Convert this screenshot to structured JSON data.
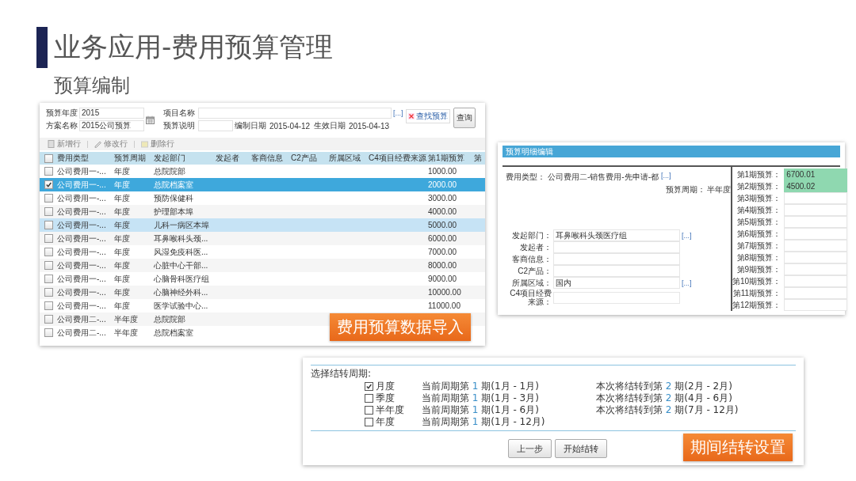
{
  "slide": {
    "title": "业务应用-费用预算管理",
    "subtitle": "预算编制"
  },
  "budget_list": {
    "form": {
      "year_label": "预算年度",
      "year": "2015",
      "plan_label": "方案名称",
      "plan": "2015公司预算",
      "project_label": "项目名称",
      "project_more": "[...]",
      "note_label": "预算说明",
      "compiled_label": "编制日期",
      "compiled": "2015-04-12",
      "effective_label": "生效日期",
      "effective": "2015-04-13",
      "find_button": "查找预算",
      "query_button": "查询"
    },
    "toolbar": [
      {
        "label": "新增行",
        "disabled": true
      },
      {
        "label": "修改行",
        "disabled": true
      },
      {
        "label": "删除行",
        "disabled": true
      }
    ],
    "header_checked": false,
    "columns": [
      "费用类型",
      "预算周期",
      "发起部门",
      "发起者",
      "客商信息",
      "C2产品",
      "所属区域",
      "C4项目经费来源",
      "第1期预算",
      "第"
    ],
    "rows": [
      {
        "checked": false,
        "selected": false,
        "hovered": false,
        "type": "公司费用一-...",
        "period": "年度",
        "dept": "总院院部",
        "first": "1000.00"
      },
      {
        "checked": true,
        "selected": true,
        "hovered": false,
        "type": "公司费用一-...",
        "period": "年度",
        "dept": "总院档案室",
        "first": "2000.00"
      },
      {
        "checked": false,
        "selected": false,
        "hovered": false,
        "type": "公司费用一-...",
        "period": "年度",
        "dept": "预防保健科",
        "first": "3000.00"
      },
      {
        "checked": false,
        "selected": false,
        "hovered": false,
        "type": "公司费用一-...",
        "period": "年度",
        "dept": "护理部本埠",
        "first": "4000.00"
      },
      {
        "checked": false,
        "selected": false,
        "hovered": true,
        "type": "公司费用一-...",
        "period": "年度",
        "dept": "儿科一病区本埠",
        "first": "5000.00"
      },
      {
        "checked": false,
        "selected": false,
        "hovered": false,
        "type": "公司费用一-...",
        "period": "年度",
        "dept": "耳鼻喉科头颈...",
        "first": "6000.00"
      },
      {
        "checked": false,
        "selected": false,
        "hovered": false,
        "type": "公司费用一-...",
        "period": "年度",
        "dept": "风湿免疫科医...",
        "first": "7000.00"
      },
      {
        "checked": false,
        "selected": false,
        "hovered": false,
        "type": "公司费用一-...",
        "period": "年度",
        "dept": "心脏中心干部...",
        "first": "8000.00"
      },
      {
        "checked": false,
        "selected": false,
        "hovered": false,
        "type": "公司费用一-...",
        "period": "年度",
        "dept": "心脑骨科医疗组",
        "first": "9000.00"
      },
      {
        "checked": false,
        "selected": false,
        "hovered": false,
        "type": "公司费用一-...",
        "period": "年度",
        "dept": "心脑神经外科...",
        "first": "10000.00"
      },
      {
        "checked": false,
        "selected": false,
        "hovered": false,
        "type": "公司费用一-...",
        "period": "年度",
        "dept": "医学试验中心...",
        "first": "11000.00"
      },
      {
        "checked": false,
        "selected": false,
        "hovered": false,
        "type": "公司费用二-...",
        "period": "半年度",
        "dept": "总院院部"
      },
      {
        "checked": false,
        "selected": false,
        "hovered": false,
        "type": "公司费用二-...",
        "period": "半年度",
        "dept": "总院档案室"
      }
    ],
    "badge": "费用预算数据导入"
  },
  "detail": {
    "title": "预算明细编辑",
    "cost_type": {
      "label": "费用类型：",
      "value": "公司费用二-销售费用-先申请-都",
      "more": "[...]"
    },
    "period": {
      "label": "预算周期：",
      "value": "半年度"
    },
    "fields": [
      {
        "label": "发起部门：",
        "value": "耳鼻喉科头颈医疗组",
        "more": "[...]"
      },
      {
        "label": "发起者："
      },
      {
        "label": "客商信息："
      },
      {
        "label": "C2产品："
      },
      {
        "label": "所属区域：",
        "value": "国内",
        "more": "[...]"
      },
      {
        "label": "C4项目经费来源："
      }
    ],
    "budgets": [
      {
        "label": "第1期预算：",
        "value": "6700.01"
      },
      {
        "label": "第2期预算：",
        "value": "4500.02"
      },
      {
        "label": "第3期预算："
      },
      {
        "label": "第4期预算："
      },
      {
        "label": "第5期预算："
      },
      {
        "label": "第6期预算："
      },
      {
        "label": "第7期预算："
      },
      {
        "label": "第8期预算："
      },
      {
        "label": "第9期预算："
      },
      {
        "label": "第10期预算："
      },
      {
        "label": "第11期预算："
      },
      {
        "label": "第12期预算："
      }
    ]
  },
  "carryover": {
    "prompt": "选择结转周期:",
    "options": [
      {
        "label": "月度",
        "checked": true,
        "current": {
          "prefix": "当前周期第",
          "number": "1",
          "suffix": "期(1月 - 1月)"
        },
        "next": {
          "prefix": "本次将结转到第",
          "number": "2",
          "suffix": "期(2月 - 2月)"
        }
      },
      {
        "label": "季度",
        "checked": false,
        "current": {
          "prefix": "当前周期第",
          "number": "1",
          "suffix": "期(1月 - 3月)"
        },
        "next": {
          "prefix": "本次将结转到第",
          "number": "2",
          "suffix": "期(4月 - 6月)"
        }
      },
      {
        "label": "半年度",
        "checked": false,
        "current": {
          "prefix": "当前周期第",
          "number": "1",
          "suffix": "期(1月 - 6月)"
        },
        "next": {
          "prefix": "本次将结转到第",
          "number": "2",
          "suffix": "期(7月 - 12月)"
        }
      },
      {
        "label": "年度",
        "checked": false,
        "current": {
          "prefix": "当前周期第",
          "number": "1",
          "suffix": "期(1月 - 12月)"
        }
      }
    ],
    "buttons": [
      "上一步",
      "开始结转"
    ],
    "badge": "期间结转设置"
  }
}
